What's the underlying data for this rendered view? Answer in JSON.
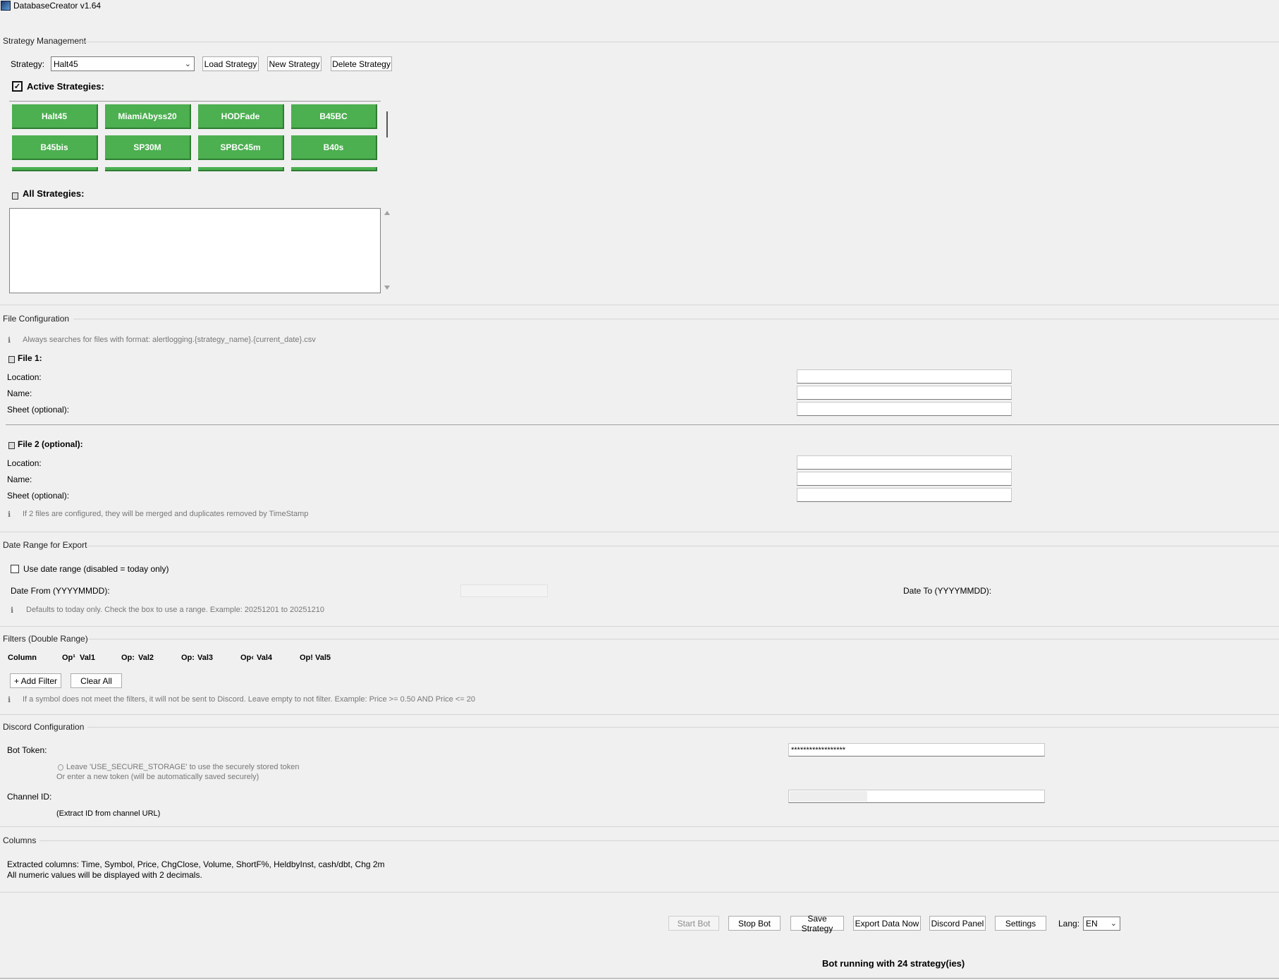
{
  "window": {
    "title": "DatabaseCreator v1.64"
  },
  "strategy_management": {
    "section_title": "Strategy Management",
    "strategy_label": "Strategy:",
    "strategy_value": "Halt45",
    "load_button": "Load Strategy",
    "new_button": "New Strategy",
    "delete_button": "Delete Strategy",
    "active_title": "Active Strategies:",
    "active_strategies": [
      "Halt45",
      "MiamiAbyss20",
      "HODFade",
      "B45BC",
      "B45bis",
      "SP30M",
      "SPBC45m",
      "B40s"
    ],
    "all_title": "All Strategies:"
  },
  "file_config": {
    "section_title": "File Configuration",
    "info": "Always searches for files with format: alertlogging.{strategy_name}.{current_date}.csv",
    "file1_title": "File 1:",
    "file2_title": "File 2 (optional):",
    "location_label": "Location:",
    "name_label": "Name:",
    "sheet_label": "Sheet (optional):",
    "merge_info": "If 2 files are configured, they will be merged and duplicates removed by TimeStamp",
    "info_glyph": "ℹ"
  },
  "date_range": {
    "section_title": "Date Range for Export",
    "use_range_label": "Use date range (disabled = today only)",
    "use_range_checked": false,
    "date_from_label": "Date From (YYYYMMDD):",
    "date_to_label": "Date To (YYYYMMDD):",
    "info": "Defaults to today only. Check the box to use a range. Example: 20251201 to 20251210"
  },
  "filters": {
    "section_title": "Filters (Double Range)",
    "headers": [
      "Column",
      "Op¹",
      "Val1",
      "Op:",
      "Val2",
      "Op:",
      "Val3",
      "Op‹",
      "Val4",
      "Op!",
      "Val5"
    ],
    "add_button": "+ Add Filter",
    "clear_button": "Clear All",
    "info": "If a symbol does not meet the filters, it will not be sent to Discord. Leave empty to not filter. Example: Price >= 0.50 AND Price <= 20"
  },
  "discord": {
    "section_title": "Discord Configuration",
    "token_label": "Bot Token:",
    "token_value": "******************",
    "token_hint1": "Leave 'USE_SECURE_STORAGE' to use the securely stored token",
    "token_hint2": "Or enter a new token (will be automatically saved securely)",
    "channel_label": "Channel ID:",
    "channel_hint": "(Extract ID from channel URL)"
  },
  "columns": {
    "section_title": "Columns",
    "line1": "Extracted columns: Time, Symbol, Price, ChgClose, Volume, ShortF%, HeldbyInst, cash/dbt, Chg 2m",
    "line2": "All numeric values will be displayed with 2 decimals."
  },
  "footer": {
    "start_button": "Start Bot",
    "stop_button": "Stop Bot",
    "save_button": "Save Strategy",
    "export_button": "Export Data Now",
    "discord_button": "Discord Panel",
    "settings_button": "Settings",
    "lang_label": "Lang:",
    "lang_value": "EN",
    "status": "Bot running with 24 strategy(ies)"
  },
  "colors": {
    "active_green": "#4caf50",
    "active_green_dark": "#2e7d32"
  }
}
